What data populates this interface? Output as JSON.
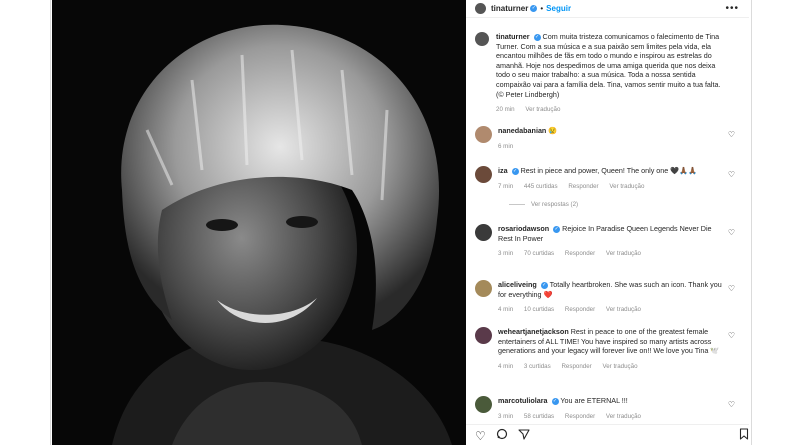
{
  "post": {
    "username": "tinaturner",
    "follow_label": "Seguir",
    "more_label": "•••",
    "caption_user": "tinaturner",
    "caption_text": "Com muita tristeza comunicamos o falecimento de Tina Turner. Com a sua música e a sua paixão sem limites pela vida, ela encantou milhões de fãs em todo o mundo e inspirou as estrelas do amanhã. Hoje nos despedimos de uma amiga querida que nos deixa todo o seu maior trabalho: a sua música. Toda a nossa sentida compaixão vai para a família dela. Tina, vamos sentir muito a tua falta. (© Peter Lindbergh)",
    "time": "20 min",
    "translate": "Ver tradução"
  },
  "comments": [
    {
      "user": "nanedabanian",
      "verified": false,
      "text": "😢",
      "time": "6 min",
      "likes": "",
      "reply": "",
      "translate": ""
    },
    {
      "user": "iza",
      "verified": true,
      "text": "Rest in piece and power, Queen! The only one 🖤🙏🏾🙏🏾",
      "time": "7 min",
      "likes": "445 curtidas",
      "reply": "Responder",
      "translate": "Ver tradução"
    },
    {
      "user": "rosariodawson",
      "verified": true,
      "text": "Rejoice In Paradise Queen Legends Never Die Rest In Power",
      "time": "3 min",
      "likes": "70 curtidas",
      "reply": "Responder",
      "translate": "Ver tradução"
    },
    {
      "user": "aliceliveing",
      "verified": true,
      "text": "Totally heartbroken. She was such an icon. Thank you for everything ❤️",
      "time": "4 min",
      "likes": "10 curtidas",
      "reply": "Responder",
      "translate": "Ver tradução"
    },
    {
      "user": "weheartjanetjackson",
      "verified": false,
      "text": "Rest in peace to one of the greatest female entertainers of ALL TIME! You have inspired so many artists across generations and your legacy will forever live on!! We love you Tina 🕊️",
      "time": "4 min",
      "likes": "3 curtidas",
      "reply": "Responder",
      "translate": "Ver tradução"
    },
    {
      "user": "marcotuliolara",
      "verified": true,
      "text": "You are ETERNAL !!!",
      "time": "3 min",
      "likes": "58 curtidas",
      "reply": "Responder",
      "translate": "Ver tradução"
    }
  ],
  "view_replies": "Ver respostas (2)",
  "colors": {
    "accent": "#0095f6",
    "verified": "#3897f0",
    "muted": "#8e8e8e"
  },
  "icons": {
    "like": "heart-icon",
    "comment": "comment-icon",
    "share": "share-icon",
    "save": "bookmark-icon"
  }
}
